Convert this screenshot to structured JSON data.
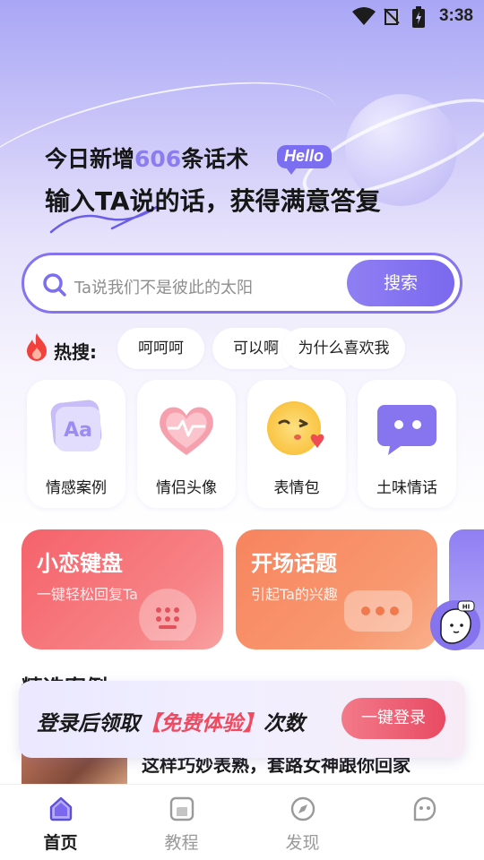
{
  "status": {
    "time": "3:38"
  },
  "header": {
    "line1_prefix": "今日新增",
    "line1_number": "606",
    "line1_suffix": "条话术",
    "hello_badge": "Hello",
    "line2": "输入TA说的话，获得满意答复"
  },
  "search": {
    "placeholder": "Ta说我们不是彼此的太阳",
    "button": "搜索"
  },
  "hot": {
    "label": "热搜:",
    "chips": [
      "呵呵呵",
      "可以啊",
      "为什么喜欢我"
    ]
  },
  "categories": [
    {
      "label": "情感案例",
      "icon": "aa-card-icon"
    },
    {
      "label": "情侣头像",
      "icon": "heart-pulse-icon"
    },
    {
      "label": "表情包",
      "icon": "wink-emoji-icon"
    },
    {
      "label": "土味情话",
      "icon": "chat-bubble-icon"
    }
  ],
  "features": [
    {
      "title": "小恋键盘",
      "subtitle": "一键轻松回复Ta",
      "icon": "keyboard-icon"
    },
    {
      "title": "开场话题",
      "subtitle": "引起Ta的兴趣",
      "icon": "chat-dots-icon"
    }
  ],
  "floating_bot": {
    "bubble": "HI"
  },
  "section": {
    "title": "精选案例"
  },
  "article": {
    "title": "这样巧妙表熟，套路女神跟你回家"
  },
  "login_banner": {
    "text_prefix": "登录后领取",
    "text_highlight": "【免费体验】",
    "text_suffix": "次数",
    "button": "一键登录"
  },
  "tabs": [
    {
      "label": "首页",
      "icon": "home-icon",
      "active": true
    },
    {
      "label": "教程",
      "icon": "book-icon",
      "active": false
    },
    {
      "label": "发现",
      "icon": "compass-icon",
      "active": false
    },
    {
      "label": "",
      "icon": "chat-face-icon",
      "active": false
    }
  ],
  "colors": {
    "primary": "#8574ee",
    "accent_red": "#ef4a5f",
    "feature1": "#f5626a",
    "feature2": "#f7845e"
  }
}
